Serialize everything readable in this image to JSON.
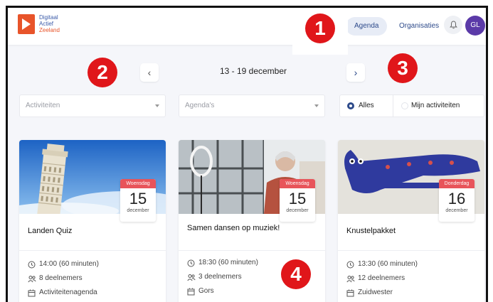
{
  "header": {
    "logo_lines": [
      "Digitaal",
      "Actief",
      "Zeeland"
    ],
    "nav": [
      {
        "label": "Agenda",
        "active": true
      },
      {
        "label": "Organisaties",
        "active": false
      }
    ],
    "avatar_initials": "GL"
  },
  "badges": [
    "1",
    "2",
    "3",
    "4"
  ],
  "week": {
    "label": "13 - 19 december",
    "prev_icon": "chevron-left-icon",
    "next_icon": "chevron-right-icon"
  },
  "filters": {
    "activities_placeholder": "Activiteiten",
    "agendas_placeholder": "Agenda's",
    "radio_options": [
      {
        "label": "Alles",
        "checked": true
      },
      {
        "label": "Mijn activiteiten",
        "checked": false
      }
    ]
  },
  "cards": [
    {
      "title": "Landen Quiz",
      "weekday": "Woensdag",
      "day": "15",
      "month": "december",
      "time": "14:00 (60 minuten)",
      "participants": "8 deelnemers",
      "agenda": "Activiteitenagenda"
    },
    {
      "title": "Samen dansen op muziek!",
      "weekday": "Woensdag",
      "day": "15",
      "month": "december",
      "time": "18:30 (60 minuten)",
      "participants": "3 deelnemers",
      "agenda": "Gors"
    },
    {
      "title": "Knustelpakket",
      "weekday": "Donderdag",
      "day": "16",
      "month": "december",
      "time": "13:30 (60 minuten)",
      "participants": "12 deelnemers",
      "agenda": "Zuidwester"
    }
  ],
  "colors": {
    "brand_blue": "#2d4a8a",
    "brand_orange": "#e8542a",
    "badge_red": "#e0161a",
    "date_red": "#e8545a",
    "avatar_purple": "#5b3aa8"
  }
}
